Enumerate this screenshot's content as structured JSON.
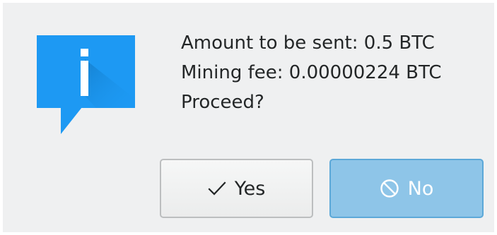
{
  "dialog": {
    "icon": "information-icon",
    "message_lines": [
      "Amount to be sent: 0.5 BTC",
      "Mining fee: 0.00000224 BTC",
      "Proceed?"
    ],
    "buttons": {
      "yes": {
        "label": "Yes",
        "icon": "checkmark-icon"
      },
      "no": {
        "label": "No",
        "icon": "cancel-icon"
      }
    }
  },
  "colors": {
    "dialog_bg": "#eff0f1",
    "icon_blue": "#1d99f3",
    "text": "#232627",
    "no_button_bg": "#8ec5e8",
    "no_button_border": "#5ca8d8"
  }
}
